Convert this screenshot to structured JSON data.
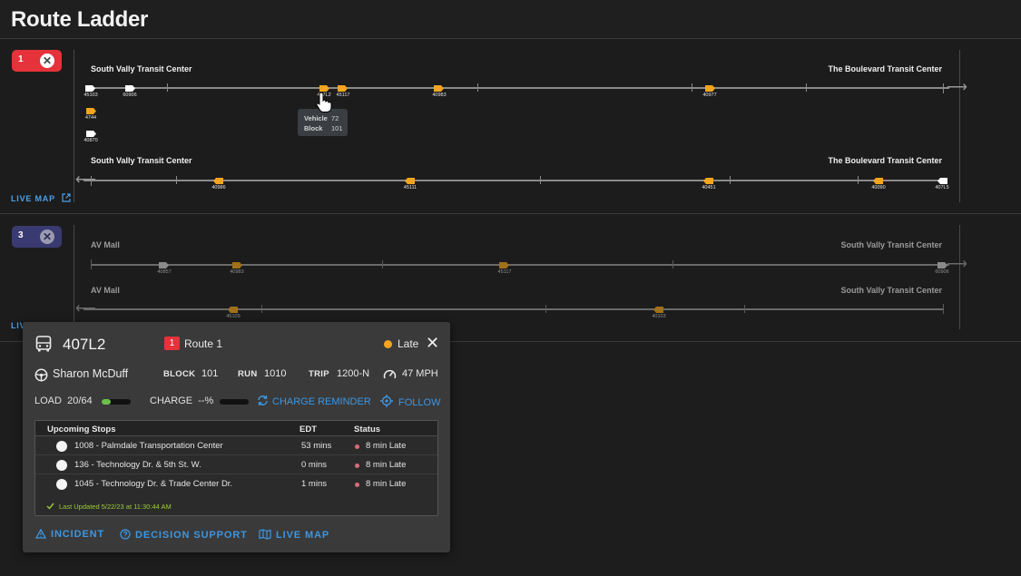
{
  "header": {
    "title": "Route Ladder"
  },
  "route1": {
    "number": "1",
    "close_icon": "close-icon",
    "live_map_label": "LIVE MAP",
    "accent": "#e5323b",
    "outbound": {
      "start": "South Vally Transit Center",
      "end": "The Boulevard Transit Center",
      "vehicles": [
        "45103",
        "60906",
        "407L2",
        "45117",
        "40983",
        "40977"
      ]
    },
    "queued_vehicles": [
      "4744",
      "40870"
    ],
    "inbound": {
      "start": "South Vally Transit Center",
      "end": "The Boulevard Transit Center",
      "vehicles": [
        "40986",
        "45111",
        "40451",
        "40090",
        "407L5"
      ]
    },
    "tooltip": {
      "vehicle_label": "Vehicle",
      "vehicle_value": "72",
      "block_label": "Block",
      "block_value": "101"
    }
  },
  "route3": {
    "number": "3",
    "live_map_label": "LIV",
    "accent": "#3a3a72",
    "outbound": {
      "start": "AV Mall",
      "end": "South Vally Transit Center",
      "vehicles": [
        "40857",
        "40983",
        "45117",
        "60906"
      ]
    },
    "inbound": {
      "start": "AV Mall",
      "end": "South Vally Transit Center",
      "vehicles": [
        "45109",
        "40103"
      ]
    }
  },
  "popup": {
    "vehicle_id": "407L2",
    "route_badge": "1",
    "route_name": "Route 1",
    "status": "Late",
    "status_color": "#f3a51f",
    "driver": "Sharon McDuff",
    "block_label": "BLOCK",
    "block_value": "101",
    "run_label": "RUN",
    "run_value": "1010",
    "trip_label": "TRIP",
    "trip_value": "1200-N",
    "speed": "47 MPH",
    "load_label": "LOAD",
    "load_value": "20/64",
    "load_fraction": 0.31,
    "charge_label": "CHARGE",
    "charge_value": "--%",
    "charge_reminder_label": "CHARGE REMINDER",
    "follow_label": "FOLLOW",
    "stops_table": {
      "headers": [
        "Upcoming Stops",
        "EDT",
        "Status"
      ],
      "rows": [
        {
          "stop": "1008 - Palmdale Transportation Center",
          "edt": "53 mins",
          "status": "8 min Late"
        },
        {
          "stop": "136 - Technology Dr. & 5th St. W.",
          "edt": "0 mins",
          "status": "8 min Late"
        },
        {
          "stop": "1045 - Technology Dr. & Trade Center Dr.",
          "edt": "1 mins",
          "status": "8 min Late"
        }
      ],
      "last_updated": "Last Updated 5/22/23 at 11:30:44 AM"
    },
    "actions": {
      "incident": "INCIDENT",
      "decision_support": "DECISION SUPPORT",
      "live_map": "LIVE MAP"
    }
  }
}
